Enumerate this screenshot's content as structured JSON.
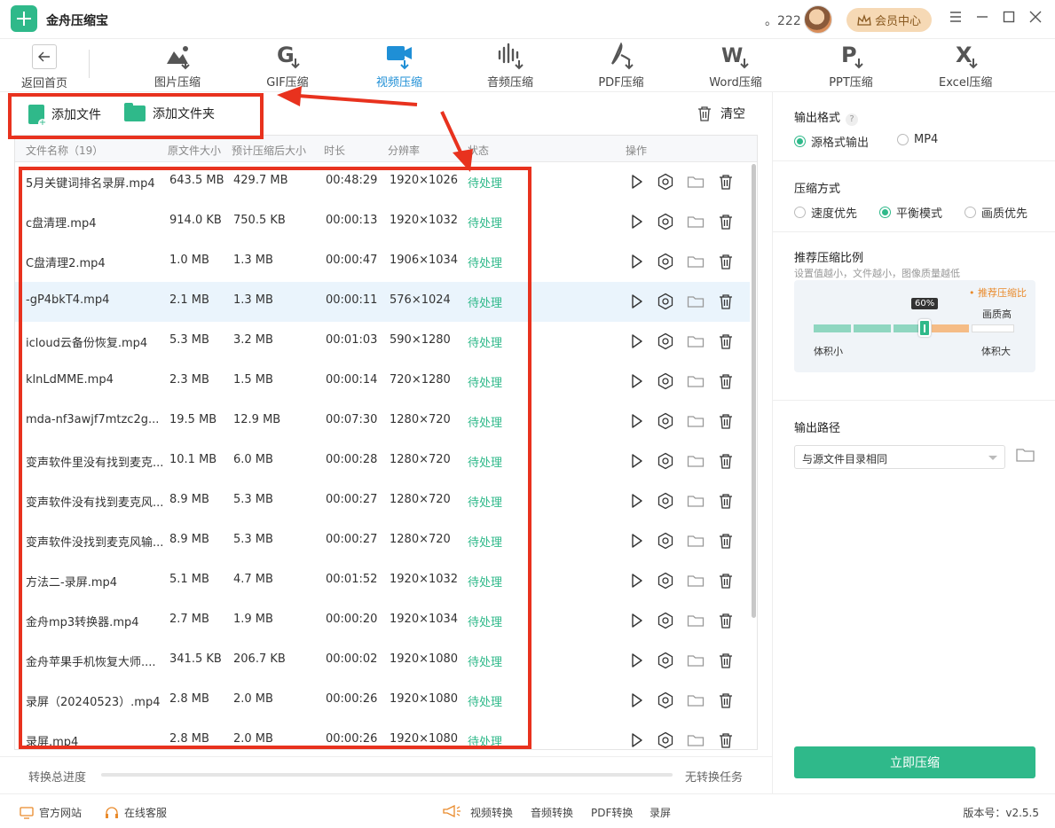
{
  "app": {
    "title": "金舟压缩宝",
    "user_count": "。222",
    "member_label": "会员中心"
  },
  "toolbar": {
    "back_label": "返回首页",
    "tools": [
      {
        "label": "图片压缩",
        "icon": "image-compress-icon"
      },
      {
        "label": "GIF压缩",
        "icon": "gif-compress-icon"
      },
      {
        "label": "视频压缩",
        "icon": "video-compress-icon",
        "active": true
      },
      {
        "label": "音频压缩",
        "icon": "audio-compress-icon"
      },
      {
        "label": "PDF压缩",
        "icon": "pdf-compress-icon"
      },
      {
        "label": "Word压缩",
        "icon": "word-compress-icon"
      },
      {
        "label": "PPT压缩",
        "icon": "ppt-compress-icon"
      },
      {
        "label": "Excel压缩",
        "icon": "excel-compress-icon"
      }
    ]
  },
  "file_actions": {
    "add_file": "添加文件",
    "add_folder": "添加文件夹",
    "clear": "清空"
  },
  "table": {
    "headers": [
      "文件名称（19）",
      "原文件大小",
      "预计压缩后大小",
      "时长",
      "分辨率",
      "状态",
      "操作"
    ],
    "rows": [
      {
        "name": "5月关键词排名录屏.mp4",
        "size": "643.5 MB",
        "est": "429.7 MB",
        "duration": "00:48:29",
        "res": "1920×1026",
        "status": "待处理"
      },
      {
        "name": "c盘清理.mp4",
        "size": "914.0 KB",
        "est": "750.5 KB",
        "duration": "00:00:13",
        "res": "1920×1032",
        "status": "待处理"
      },
      {
        "name": "C盘清理2.mp4",
        "size": "1.0 MB",
        "est": "1.3 MB",
        "duration": "00:00:47",
        "res": "1906×1034",
        "status": "待处理"
      },
      {
        "name": "-gP4bkT4.mp4",
        "size": "2.1 MB",
        "est": "1.3 MB",
        "duration": "00:00:11",
        "res": "576×1024",
        "status": "待处理",
        "highlight": true
      },
      {
        "name": "icloud云备份恢复.mp4",
        "size": "5.3 MB",
        "est": "3.2 MB",
        "duration": "00:01:03",
        "res": "590×1280",
        "status": "待处理"
      },
      {
        "name": "klnLdMME.mp4",
        "size": "2.3 MB",
        "est": "1.5 MB",
        "duration": "00:00:14",
        "res": "720×1280",
        "status": "待处理"
      },
      {
        "name": "mda-nf3awjf7mtzc2g...",
        "size": "19.5 MB",
        "est": "12.9 MB",
        "duration": "00:07:30",
        "res": "1280×720",
        "status": "待处理"
      },
      {
        "name": "变声软件里没有找到麦克...",
        "size": "10.1 MB",
        "est": "6.0 MB",
        "duration": "00:00:28",
        "res": "1280×720",
        "status": "待处理"
      },
      {
        "name": "变声软件没有找到麦克风...",
        "size": "8.9 MB",
        "est": "5.3 MB",
        "duration": "00:00:27",
        "res": "1280×720",
        "status": "待处理"
      },
      {
        "name": "变声软件没找到麦克风输...",
        "size": "8.9 MB",
        "est": "5.3 MB",
        "duration": "00:00:27",
        "res": "1280×720",
        "status": "待处理"
      },
      {
        "name": "方法二-录屏.mp4",
        "size": "5.1 MB",
        "est": "4.7 MB",
        "duration": "00:01:52",
        "res": "1920×1032",
        "status": "待处理"
      },
      {
        "name": "金舟mp3转换器.mp4",
        "size": "2.7 MB",
        "est": "1.9 MB",
        "duration": "00:00:20",
        "res": "1920×1034",
        "status": "待处理"
      },
      {
        "name": "金舟苹果手机恢复大师....",
        "size": "341.5 KB",
        "est": "206.7 KB",
        "duration": "00:00:02",
        "res": "1920×1080",
        "status": "待处理"
      },
      {
        "name": "录屏（20240523）.mp4",
        "size": "2.8 MB",
        "est": "2.0 MB",
        "duration": "00:00:26",
        "res": "1920×1080",
        "status": "待处理"
      },
      {
        "name": "录屏.mp4",
        "size": "2.8 MB",
        "est": "2.0 MB",
        "duration": "00:00:26",
        "res": "1920×1080",
        "status": "待处理"
      }
    ]
  },
  "progress": {
    "label": "转换总进度",
    "value": 0,
    "status": "无转换任务"
  },
  "settings": {
    "output_format": {
      "title": "输出格式",
      "options": [
        "源格式输出",
        "MP4"
      ],
      "selected": 0
    },
    "compress_mode": {
      "title": "压缩方式",
      "options": [
        "速度优先",
        "平衡模式",
        "画质优先"
      ],
      "selected": 1
    },
    "ratio": {
      "title": "推荐压缩比例",
      "hint": "设置值越小，文件越小，图像质量越低",
      "note": "• 推荐压缩比",
      "value_label": "60%",
      "value": 60,
      "high_label": "画质高",
      "small_label": "体积小",
      "large_label": "体积大"
    },
    "output_path": {
      "title": "输出路径",
      "value": "与源文件目录相同"
    },
    "compress_button": "立即压缩"
  },
  "footer": {
    "official_site": "官方网站",
    "online_service": "在线客服",
    "links": [
      "视频转换",
      "音频转换",
      "PDF转换",
      "录屏"
    ],
    "version": "版本号：v2.5.5"
  },
  "colors": {
    "accent": "#2fb98a",
    "active_tab": "#1f8fd6",
    "annotation": "#e8321e",
    "member_bg": "#f6d9b5"
  }
}
